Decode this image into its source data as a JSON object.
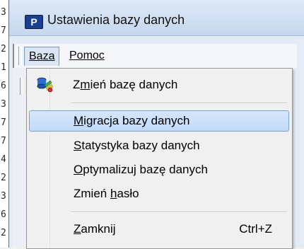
{
  "window": {
    "title": "Ustawienia bazy danych",
    "app_icon_letter": "P"
  },
  "menubar": {
    "menus": [
      "Baza",
      "Pomoc"
    ]
  },
  "dropdown": {
    "items": [
      {
        "label_pre": "Z",
        "label_u": "m",
        "label_post": "ień bazę danych"
      },
      {
        "label_pre": "",
        "label_u": "M",
        "label_post": "igracja bazy danych"
      },
      {
        "label_pre": "",
        "label_u": "S",
        "label_post": "tatystyka bazy danych"
      },
      {
        "label_pre": "",
        "label_u": "O",
        "label_post": "ptymalizuj bazę danych"
      },
      {
        "label_pre": "Zmień ",
        "label_u": "h",
        "label_post": "asło"
      },
      {
        "label_pre": "",
        "label_u": "Z",
        "label_post": "amknij",
        "accelerator": "Ctrl+Z"
      }
    ]
  },
  "background_chars": [
    "3",
    "7",
    "2",
    "1",
    "6",
    "3",
    "7",
    "7",
    "4",
    "2",
    "3",
    "6",
    "2"
  ]
}
